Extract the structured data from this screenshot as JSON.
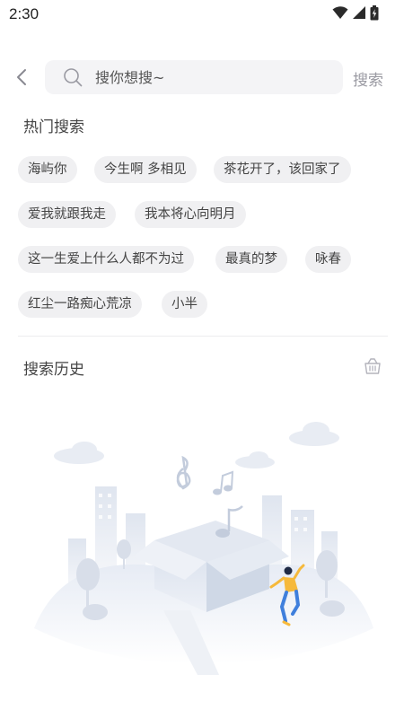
{
  "status_bar": {
    "time": "2:30",
    "icons": [
      "wifi-icon",
      "cellular-signal-icon",
      "battery-charging-icon"
    ]
  },
  "search": {
    "placeholder": "搜你想搜~",
    "submit_label": "搜索"
  },
  "hot_search": {
    "title": "热门搜索",
    "tags": [
      "海屿你",
      "今生啊 多相见",
      "茶花开了，该回家了",
      "爱我就跟我走",
      "我本将心向明月",
      "这一生爱上什么人都不为过",
      "最真的梦",
      "咏春",
      "红尘一路痴心荒凉",
      "小半"
    ]
  },
  "history": {
    "title": "搜索历史",
    "clear_icon": "trash-basket-icon"
  },
  "colors": {
    "tag_bg": "#f0f0f2",
    "search_bg": "#f4f4f6",
    "muted_text": "#9a9aa2",
    "illustration_accent": "#f6b93b"
  }
}
